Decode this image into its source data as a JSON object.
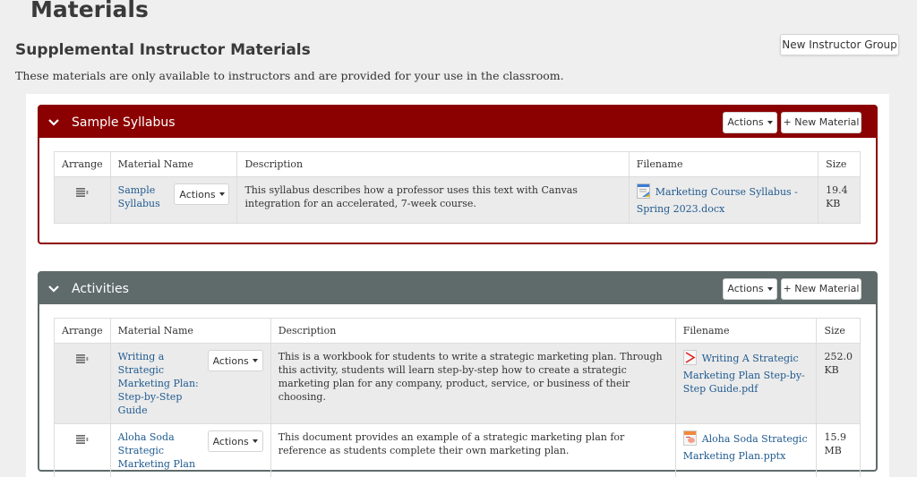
{
  "page": {
    "title": "Materials",
    "section_title": "Supplemental Instructor Materials",
    "section_description": "These materials are only available to instructors and are provided for your use in the classroom.",
    "new_group_label": "New Instructor Group"
  },
  "colors": {
    "syllabus_header": "#8b0000",
    "activities_header": "#5f6b6b",
    "link": "#1f5a8f"
  },
  "table_headers": {
    "arrange": "Arrange",
    "material_name": "Material Name",
    "description": "Description",
    "filename": "Filename",
    "size": "Size"
  },
  "groups": [
    {
      "title": "Sample Syllabus",
      "actions_label": "Actions",
      "new_material_label": "+ New Material",
      "items": [
        {
          "name": "Sample Syllabus",
          "actions_label": "Actions",
          "description": "This syllabus describes how a professor uses this text with Canvas integration for an accelerated, 7-week course.",
          "filename": "Marketing Course Syllabus - Spring 2023.docx",
          "file_icon": "docx-file-icon",
          "size": "19.4 KB"
        }
      ]
    },
    {
      "title": "Activities",
      "actions_label": "Actions",
      "new_material_label": "+ New Material",
      "items": [
        {
          "name": "Writing a Strategic Marketing Plan: Step-by-Step Guide",
          "actions_label": "Actions",
          "description": "This is a workbook for students to write a strategic marketing plan. Through this activity, students will learn step-by-step how to create a strategic marketing plan for any company, product, service, or business of their choosing.",
          "filename": "Writing A Strategic Marketing Plan Step-by-Step Guide.pdf",
          "file_icon": "pdf-file-icon",
          "size": "252.0 KB"
        },
        {
          "name": "Aloha Soda Strategic Marketing Plan",
          "actions_label": "Actions",
          "description": "This document provides an example of a strategic marketing plan for reference as students complete their own marketing plan.",
          "filename": "Aloha Soda Strategic Marketing Plan.pptx",
          "file_icon": "pptx-file-icon",
          "size": "15.9 MB"
        }
      ]
    }
  ]
}
